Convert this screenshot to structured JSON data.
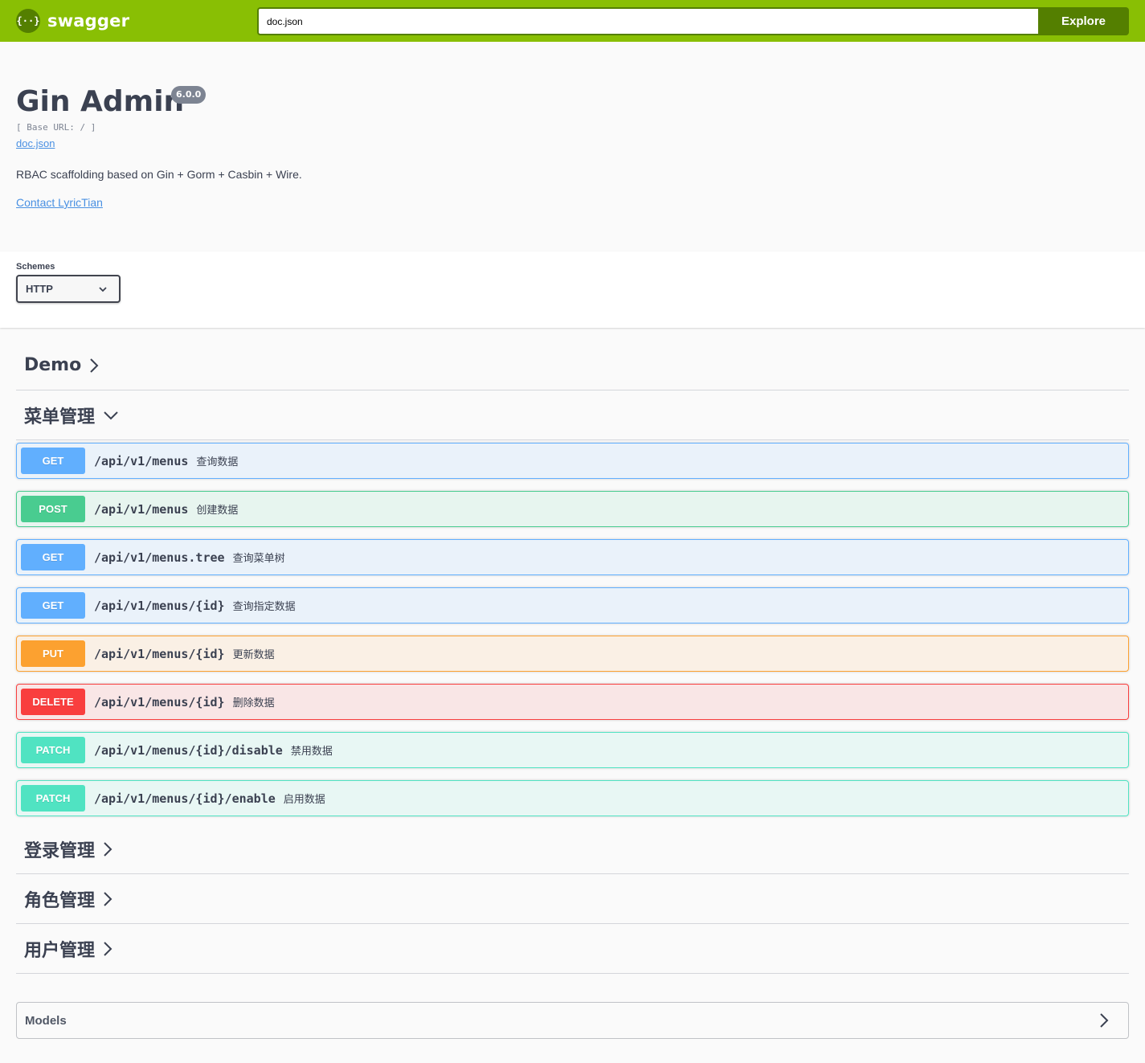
{
  "topbar": {
    "logo_glyph": "{··}",
    "logo_text": "swagger",
    "url_value": "doc.json",
    "explore_label": "Explore",
    "background_color": "#89bf04",
    "accent_color": "#547f00"
  },
  "info": {
    "title": "Gin Admin",
    "version": "6.0.0",
    "base_url": "[ Base URL: / ]",
    "spec_link": "doc.json",
    "description": "RBAC scaffolding based on Gin + Gorm + Casbin + Wire.",
    "contact": "Contact LyricTian"
  },
  "schemes": {
    "label": "Schemes",
    "selected": "HTTP"
  },
  "tags": [
    {
      "name": "Demo",
      "expanded": false
    },
    {
      "name": "菜单管理",
      "expanded": true
    },
    {
      "name": "登录管理",
      "expanded": false
    },
    {
      "name": "角色管理",
      "expanded": false
    },
    {
      "name": "用户管理",
      "expanded": false
    }
  ],
  "operations": [
    {
      "method": "GET",
      "path": "/api/v1/menus",
      "summary": "查询数据"
    },
    {
      "method": "POST",
      "path": "/api/v1/menus",
      "summary": "创建数据"
    },
    {
      "method": "GET",
      "path": "/api/v1/menus.tree",
      "summary": "查询菜单树"
    },
    {
      "method": "GET",
      "path": "/api/v1/menus/{id}",
      "summary": "查询指定数据"
    },
    {
      "method": "PUT",
      "path": "/api/v1/menus/{id}",
      "summary": "更新数据"
    },
    {
      "method": "DELETE",
      "path": "/api/v1/menus/{id}",
      "summary": "删除数据"
    },
    {
      "method": "PATCH",
      "path": "/api/v1/menus/{id}/disable",
      "summary": "禁用数据"
    },
    {
      "method": "PATCH",
      "path": "/api/v1/menus/{id}/enable",
      "summary": "启用数据"
    }
  ],
  "method_colors": {
    "GET": "#61affe",
    "POST": "#49cc90",
    "PUT": "#fca130",
    "DELETE": "#f93e3e",
    "PATCH": "#50e3c2"
  },
  "models": {
    "label": "Models"
  }
}
